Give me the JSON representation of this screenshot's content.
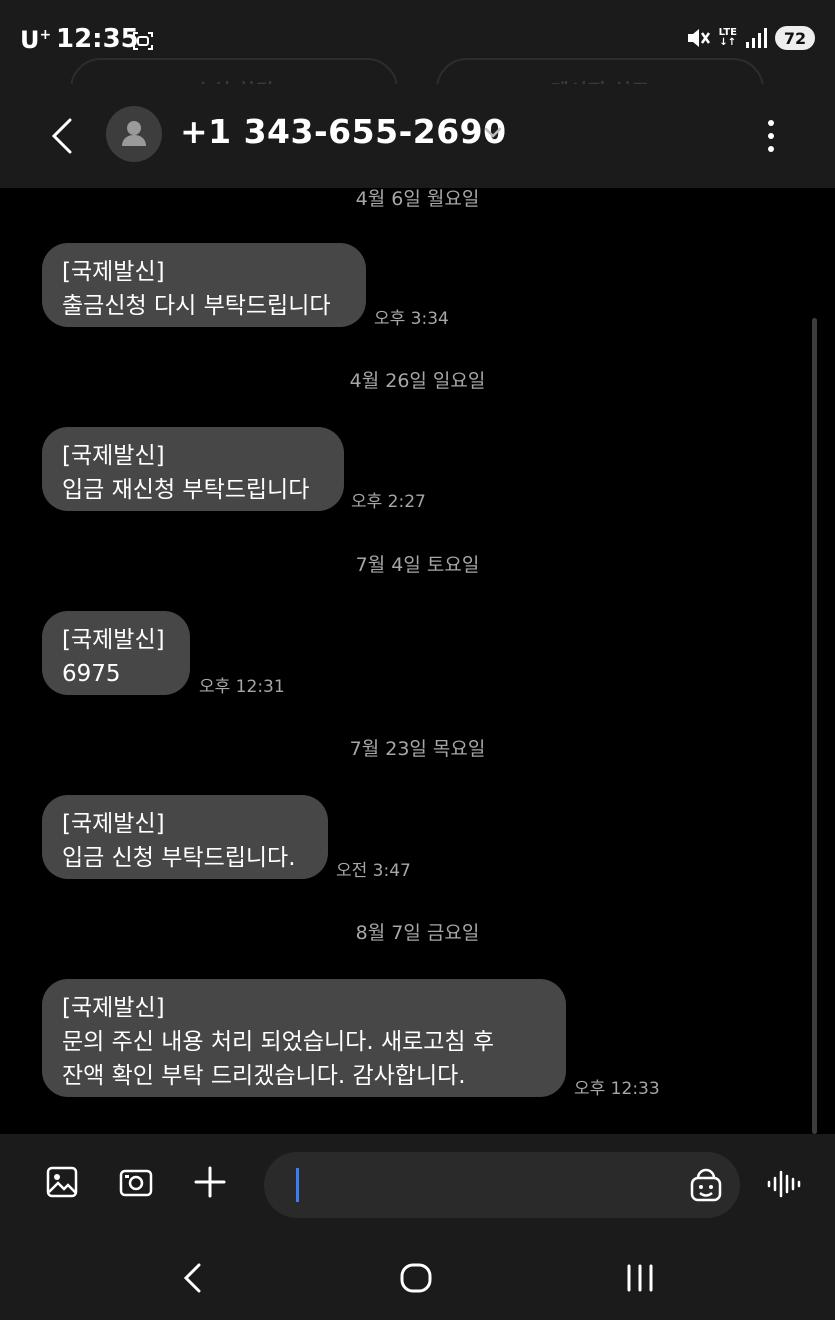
{
  "status_bar": {
    "carrier": "U",
    "carrier_sup": "+",
    "time": "12:35",
    "network": "LTE",
    "battery": "72"
  },
  "action_buttons": {
    "block": "수신 차단",
    "report": "메시지 신고"
  },
  "header": {
    "contact": "+1 343-655-2690"
  },
  "messages": [
    {
      "date": "4월 6일 월요일",
      "lines": [
        "[국제발신]",
        "출금신청 다시 부탁드립니다"
      ],
      "time": "오후 3:34"
    },
    {
      "date": "4월 26일 일요일",
      "lines": [
        "[국제발신]",
        "입금 재신청 부탁드립니다"
      ],
      "time": "오후 2:27"
    },
    {
      "date": "7월 4일 토요일",
      "lines": [
        "[국제발신]",
        "6975"
      ],
      "time": "오후 12:31"
    },
    {
      "date": "7월 23일 목요일",
      "lines": [
        "[국제발신]",
        "입금 신청 부탁드립니다."
      ],
      "time": "오전 3:47"
    },
    {
      "date": "8월 7일 금요일",
      "lines": [
        "[국제발신]",
        "문의 주신 내용 처리 되었습니다. 새로고침 후",
        "잔액 확인 부탁 드리겠습니다. 감사합니다."
      ],
      "time": "오후 12:33"
    }
  ],
  "composer": {
    "placeholder": ""
  },
  "icons": {
    "gallery": "image-icon",
    "camera": "camera-icon",
    "add": "plus-icon",
    "emoji": "emoji-icon",
    "voice": "voice-icon"
  }
}
